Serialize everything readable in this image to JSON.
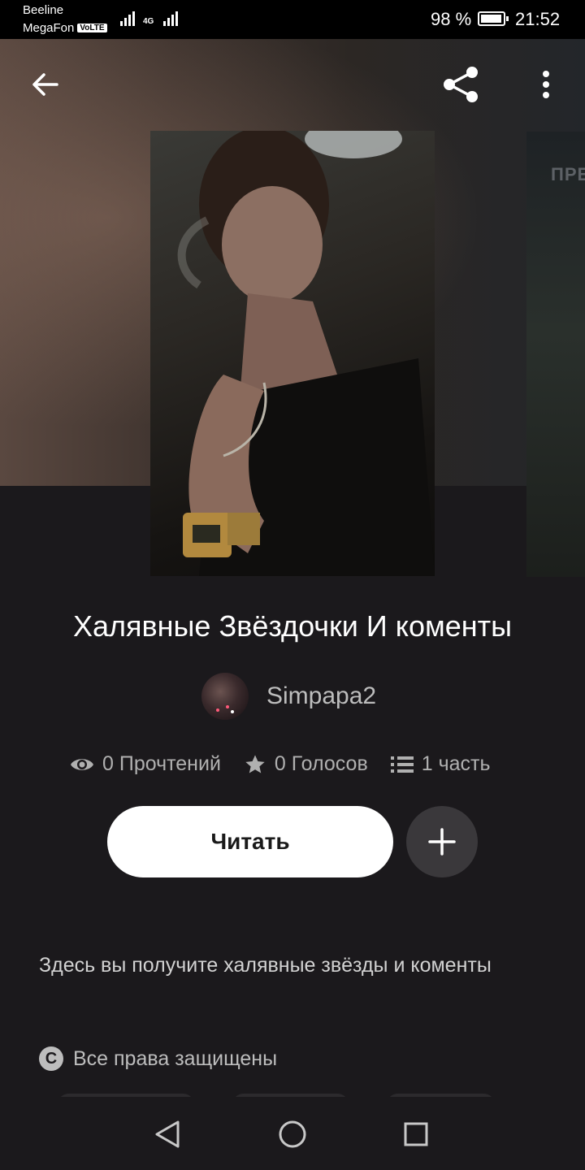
{
  "status_bar": {
    "carrier_1": "Beeline",
    "carrier_2": "MegaFon",
    "volte_badge": "VoLTE",
    "network_type": "4G",
    "battery_percent": "98 %",
    "battery_level": 0.98,
    "time": "21:52"
  },
  "header": {
    "back_icon": "arrow-left-icon",
    "share_icon": "share-icon",
    "more_icon": "more-vertical-icon"
  },
  "side_cover_text": "ПРЕ",
  "story": {
    "title": "Халявные Звёздочки И коменты",
    "author": "Simpapa2",
    "stats": {
      "reads": "0 Прочтений",
      "votes": "0 Голосов",
      "parts": "1 часть"
    },
    "read_button": "Читать",
    "description": "Здесь вы получите халявные звёзды и коменты",
    "rights": "Все права защищены",
    "copyright_symbol": "C"
  },
  "colors": {
    "background": "#1b191c",
    "read_button": "#ffffff",
    "add_button": "#3a383b",
    "muted_text": "#b0b0b0"
  }
}
